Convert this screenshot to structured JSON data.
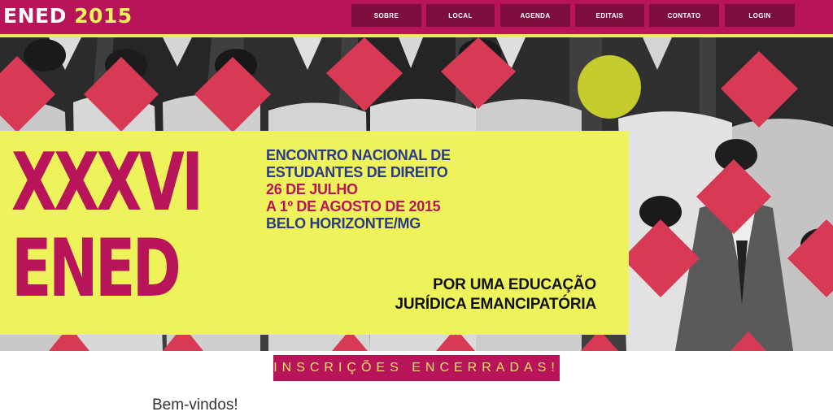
{
  "header": {
    "logo_main": "ENED",
    "logo_year": "2015",
    "nav": [
      "SOBRE",
      "LOCAL",
      "AGENDA",
      "EDITAIS",
      "CONTATO",
      "LOGIN"
    ]
  },
  "hero": {
    "title_line1": "XXXVI",
    "title_line2": "ENED",
    "event_line1": "ENCONTRO NACIONAL DE",
    "event_line2": "ESTUDANTES DE DIREITO",
    "date_line1": "26 DE JULHO",
    "date_line2": "A 1º DE AGOSTO DE 2015",
    "location": "BELO HORIZONTE/MG",
    "tagline_line1": "POR UMA EDUCAÇÃO",
    "tagline_line2": "JURÍDICA EMANCIPATÓRIA"
  },
  "registration_banner": "INSCRIÇÕES ENCERRADAS!",
  "welcome": "Bem-vindos!",
  "colors": {
    "brand_magenta": "#b8145a",
    "nav_dark": "#7c0d3d",
    "accent_yellow": "#eef35c",
    "diamond_red": "#d83a56",
    "circle_lime": "#c6cc2e",
    "text_blue": "#2b3a86"
  }
}
